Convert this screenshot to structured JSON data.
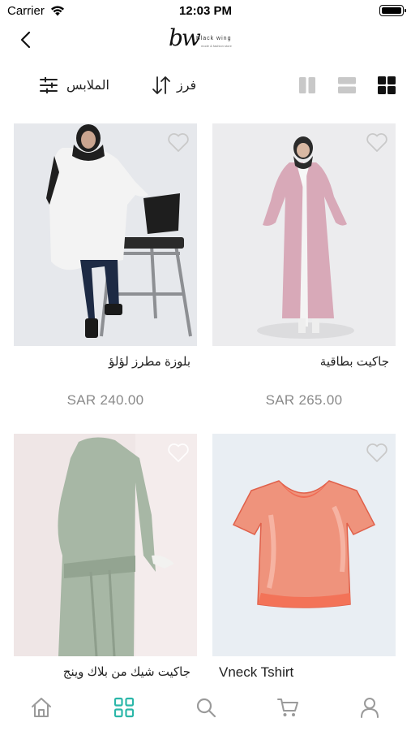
{
  "status_bar": {
    "carrier": "Carrier",
    "time": "12:03 PM"
  },
  "nav": {
    "logo_mark": "bw",
    "logo_text": "Black wing",
    "logo_sub": "mode & fashion store"
  },
  "toolbar": {
    "filter_label": "الملابس",
    "sort_label": "فرز",
    "views": [
      "two-column-view-icon",
      "list-view-icon",
      "grid-view-icon"
    ],
    "active_view": "grid-view-icon"
  },
  "products": [
    {
      "name": "جاكيت بطاقية",
      "price": "SAR 265.00",
      "favorited": false
    },
    {
      "name": "بلوزة مطرز لؤلؤ",
      "price": "SAR 240.00",
      "favorited": false
    },
    {
      "name": "Vneck Tshirt",
      "price": "",
      "favorited": false
    },
    {
      "name": "جاكيت شيك من بلاك وينج",
      "price": "",
      "favorited": false
    }
  ],
  "tab_bar": {
    "items": [
      "home-icon",
      "categories-icon",
      "search-icon",
      "cart-icon",
      "profile-icon"
    ],
    "active": "categories-icon",
    "accent": "#2bb7a9",
    "inactive": "#9a9a9a"
  }
}
